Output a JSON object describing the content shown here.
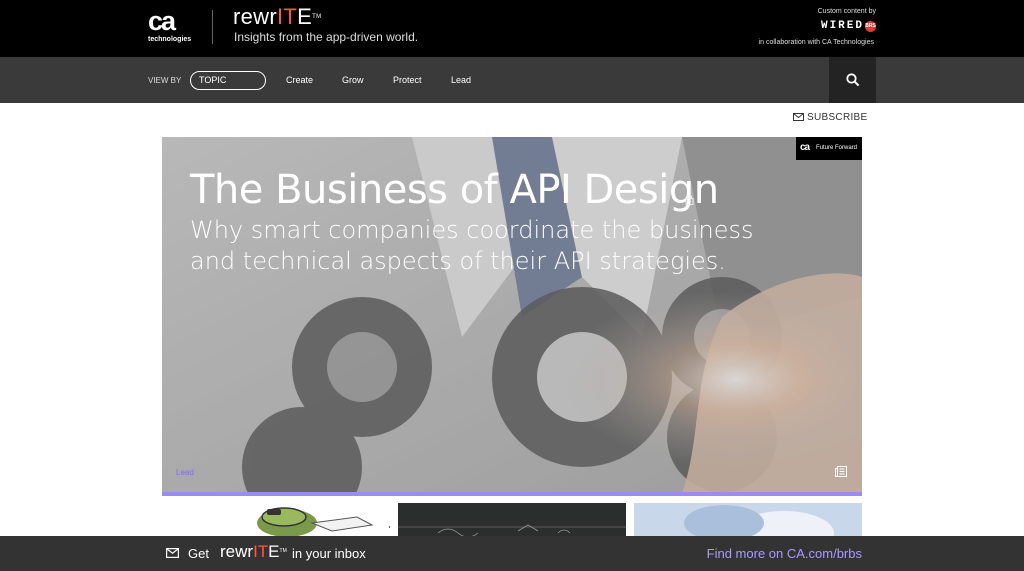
{
  "header": {
    "logo_mark": "ca",
    "logo_sub": "technologies",
    "brand_prefix": "rewr",
    "brand_highlight": "IT",
    "brand_suffix": "E",
    "brand_tm": "TM",
    "tagline": "Insights from the app-driven world.",
    "custom_content": "Custom content by",
    "wired": "WIRED",
    "brs": "BRS",
    "collab": "in collaboration with CA Technologies"
  },
  "nav": {
    "view_by": "VIEW BY",
    "topic": "TOPIC",
    "links": [
      "Create",
      "Grow",
      "Protect",
      "Lead"
    ],
    "search_icon": "search-icon"
  },
  "subscribe": {
    "label": "SUBSCRIBE",
    "icon": "mail-icon"
  },
  "hero": {
    "title": "The Business of API Design",
    "subtitle": "Why smart companies coordinate the business and technical aspects of their API strategies.",
    "badge_mark": "ca",
    "badge_text": "Future Forward",
    "tag": "Lead",
    "accent": "#9b8cf2"
  },
  "bottom": {
    "get": "Get",
    "brand_prefix": "rewr",
    "brand_highlight": "IT",
    "brand_suffix": "E",
    "brand_tm": "TM",
    "inbox": "in your inbox",
    "find_more": "Find more on CA.com/brbs"
  }
}
